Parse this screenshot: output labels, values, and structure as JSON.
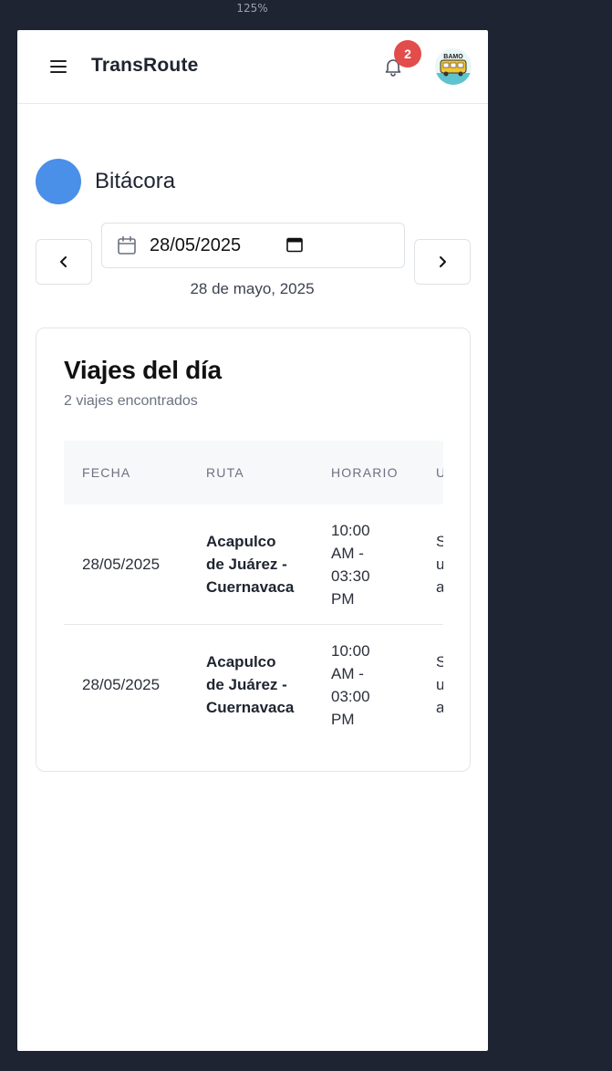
{
  "zoom": "125%",
  "header": {
    "app_title": "TransRoute",
    "notification_count": "2",
    "avatar_text": "BAMO"
  },
  "page": {
    "title": "Bitácora"
  },
  "date_picker": {
    "value": "28/05/2025",
    "long_date": "28 de mayo, 2025"
  },
  "trips_card": {
    "title": "Viajes del día",
    "subtitle": "2 viajes encontrados",
    "columns": [
      "FECHA",
      "RUTA",
      "HORARIO",
      "U"
    ],
    "rows": [
      {
        "fecha": "28/05/2025",
        "ruta": [
          "Acapulco",
          "de Juárez -",
          "Cuernavaca"
        ],
        "horario": [
          "10:00",
          "AM -",
          "03:30",
          "PM"
        ],
        "extra": [
          "S",
          "u",
          "a"
        ]
      },
      {
        "fecha": "28/05/2025",
        "ruta": [
          "Acapulco",
          "de Juárez -",
          "Cuernavaca"
        ],
        "horario": [
          "10:00",
          "AM -",
          "03:00",
          "PM"
        ],
        "extra": [
          "S",
          "u",
          "a"
        ]
      }
    ]
  },
  "colors": {
    "background": "#1f2433",
    "accent": "#4a8fe8",
    "badge": "#e24c4b"
  }
}
